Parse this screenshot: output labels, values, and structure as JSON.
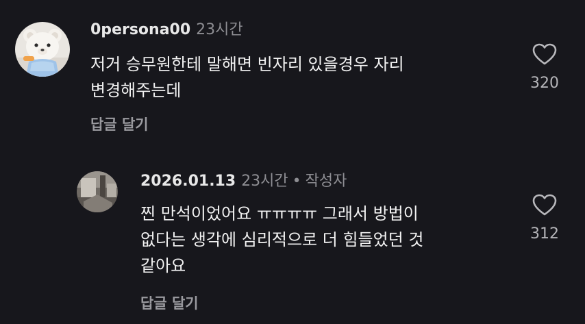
{
  "comments": [
    {
      "username": "0persona00",
      "time": "23시간",
      "lines": [
        "저거 승무원한테 말해면 빈자리 있을경우 자리",
        "변경해주는데"
      ],
      "reply_label": "답글 달기",
      "like_count": "320",
      "avatar_icon": "teddy-bear-avatar"
    },
    {
      "username": "2026.01.13",
      "time": "23시간",
      "separator": "•",
      "author_tag": "작성자",
      "lines": [
        "찐 만석이었어요 ㅠㅠㅠㅠ 그래서 방법이",
        "없다는 생각에 심리적으로 더 힘들었던 것",
        "같아요"
      ],
      "reply_label": "답글 달기",
      "like_count": "312",
      "avatar_icon": "photo-avatar"
    }
  ],
  "colors": {
    "background": "#17171c",
    "text": "#f2f2f2",
    "secondary": "#8e8e93"
  },
  "icons": {
    "like": "heart-outline-icon"
  }
}
